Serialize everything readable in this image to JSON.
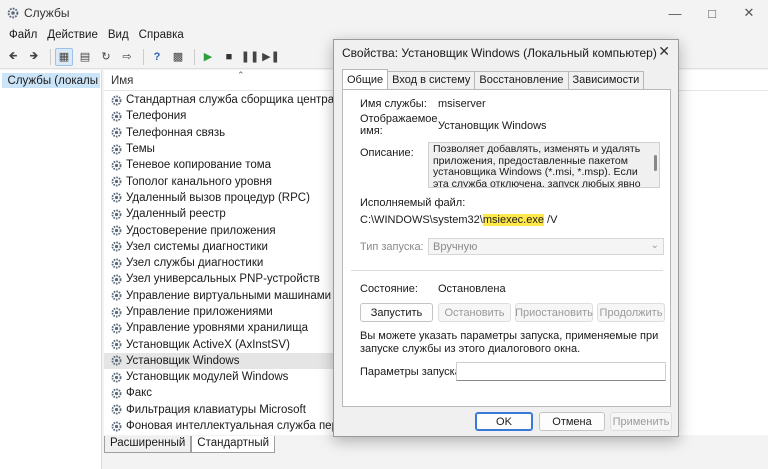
{
  "main_window": {
    "title": "Службы",
    "menu": [
      "Файл",
      "Действие",
      "Вид",
      "Справка"
    ],
    "tree_item": "Службы (локалы",
    "list_header": "Имя",
    "services": [
      "Стандартная служба сборщика центра диагн",
      "Телефония",
      "Телефонная связь",
      "Темы",
      "Теневое копирование тома",
      "Тополог канального уровня",
      "Удаленный вызов процедур (RPC)",
      "Удаленный реестр",
      "Удостоверение приложения",
      "Узел системы диагностики",
      "Узел службы диагностики",
      "Узел универсальных PNP-устройств",
      "Управление виртуальными машинами Hype",
      "Управление приложениями",
      "Управление уровнями хранилища",
      "Установщик ActiveX (AxInstSV)",
      "Установщик Windows",
      "Установщик модулей Windows",
      "Факс",
      "Фильтрация клавиатуры Microsoft",
      "Фоновая интеллектуальная служба передачи"
    ],
    "selected_index": 16,
    "bottom_tabs": [
      "Расширенный",
      "Стандартный"
    ]
  },
  "dialog": {
    "title": "Свойства: Установщик Windows (Локальный компьютер)",
    "tabs": [
      "Общие",
      "Вход в систему",
      "Восстановление",
      "Зависимости"
    ],
    "service_name_label": "Имя службы:",
    "service_name": "msiserver",
    "display_name_label": "Отображаемое имя:",
    "display_name": "Установщик Windows",
    "description_label": "Описание:",
    "description": "Позволяет добавлять, изменять и удалять приложения, предоставленные пакетом установщика Windows (*.msi, *.msp). Если эта служба отключена, запуск любых явно",
    "exe_label": "Исполняемый файл:",
    "exe_prefix": "C:\\WINDOWS\\system32\\",
    "exe_highlight": "msiexec.exe",
    "exe_suffix": " /V",
    "startup_type_label": "Тип запуска:",
    "startup_type": "Вручную",
    "status_label": "Состояние:",
    "status": "Остановлена",
    "buttons": {
      "start": "Запустить",
      "stop": "Остановить",
      "pause": "Приостановить",
      "resume": "Продолжить"
    },
    "note": "Вы можете указать параметры запуска, применяемые при запуске службы из этого диалогового окна.",
    "params_label": "Параметры запуска:",
    "ok": "OK",
    "cancel": "Отмена",
    "apply": "Применить"
  },
  "colors": {
    "highlight": "#ffe94a",
    "selection": "#cce4f7",
    "accent": "#3a78d8"
  }
}
